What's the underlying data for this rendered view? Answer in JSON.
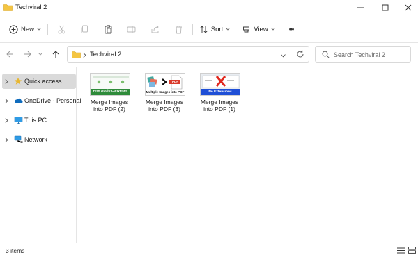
{
  "window": {
    "title": "Techviral 2"
  },
  "toolbar": {
    "new_label": "New",
    "sort_label": "Sort",
    "view_label": "View",
    "more_label": "•••"
  },
  "address": {
    "path": "Techviral 2"
  },
  "search": {
    "placeholder": "Search Techviral 2"
  },
  "sidebar": {
    "items": [
      {
        "label": "Quick access",
        "icon": "star-icon",
        "selected": true
      },
      {
        "label": "OneDrive - Personal",
        "icon": "cloud-icon",
        "selected": false
      },
      {
        "label": "This PC",
        "icon": "monitor-icon",
        "selected": false
      },
      {
        "label": "Network",
        "icon": "network-icon",
        "selected": false
      }
    ]
  },
  "files": [
    {
      "line1": "Merge Images",
      "line2": "into PDF (2)",
      "thumb_caption": "Free Audio Converter"
    },
    {
      "line1": "Merge Images",
      "line2": "into PDF (3)",
      "thumb_caption": "Multiple Images into PDF",
      "thumb_badge": "PDF"
    },
    {
      "line1": "Merge Images",
      "line2": "into PDF (1)",
      "thumb_caption": "No Extensions"
    }
  ],
  "status": {
    "item_count": "3 items"
  },
  "colors": {
    "accent": "#0067c0",
    "folder_yellow": "#f4c542",
    "selected_bg": "#dadada",
    "star": "#e8b730"
  }
}
